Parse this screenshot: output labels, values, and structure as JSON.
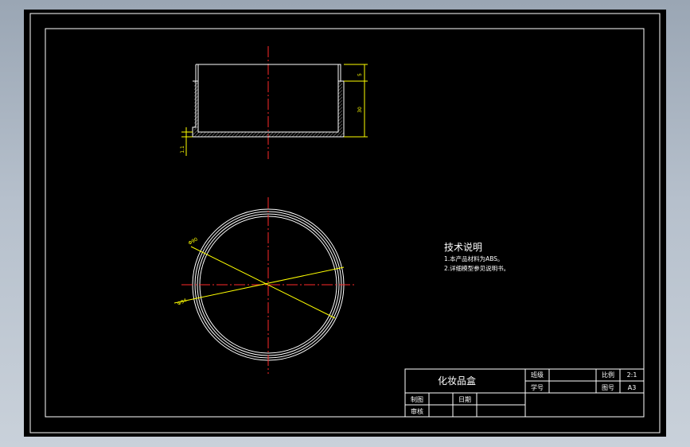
{
  "tech_notes": {
    "title": "技术说明",
    "items": [
      "1.本产品材料为ABS。",
      "2.详细模型参见说明书。"
    ]
  },
  "dimensions": {
    "top_height": "5",
    "body_height": "30",
    "base_thickness": "1.1",
    "dia_upper": "Φ90",
    "dia_lower": "Φ94"
  },
  "title_block": {
    "drawing_name": "化妆品盒",
    "label_class": "班级",
    "label_student_no": "学号",
    "label_scale": "比例",
    "value_scale": "2:1",
    "label_sheet": "图号",
    "value_sheet": "A3",
    "label_drawn": "制图",
    "label_date": "日期",
    "label_checked": "审核"
  },
  "colors": {
    "canvas": "#000000",
    "lines": "#ffffff",
    "centerlines": "#ff2a2a",
    "dimensions": "#ffff00"
  }
}
